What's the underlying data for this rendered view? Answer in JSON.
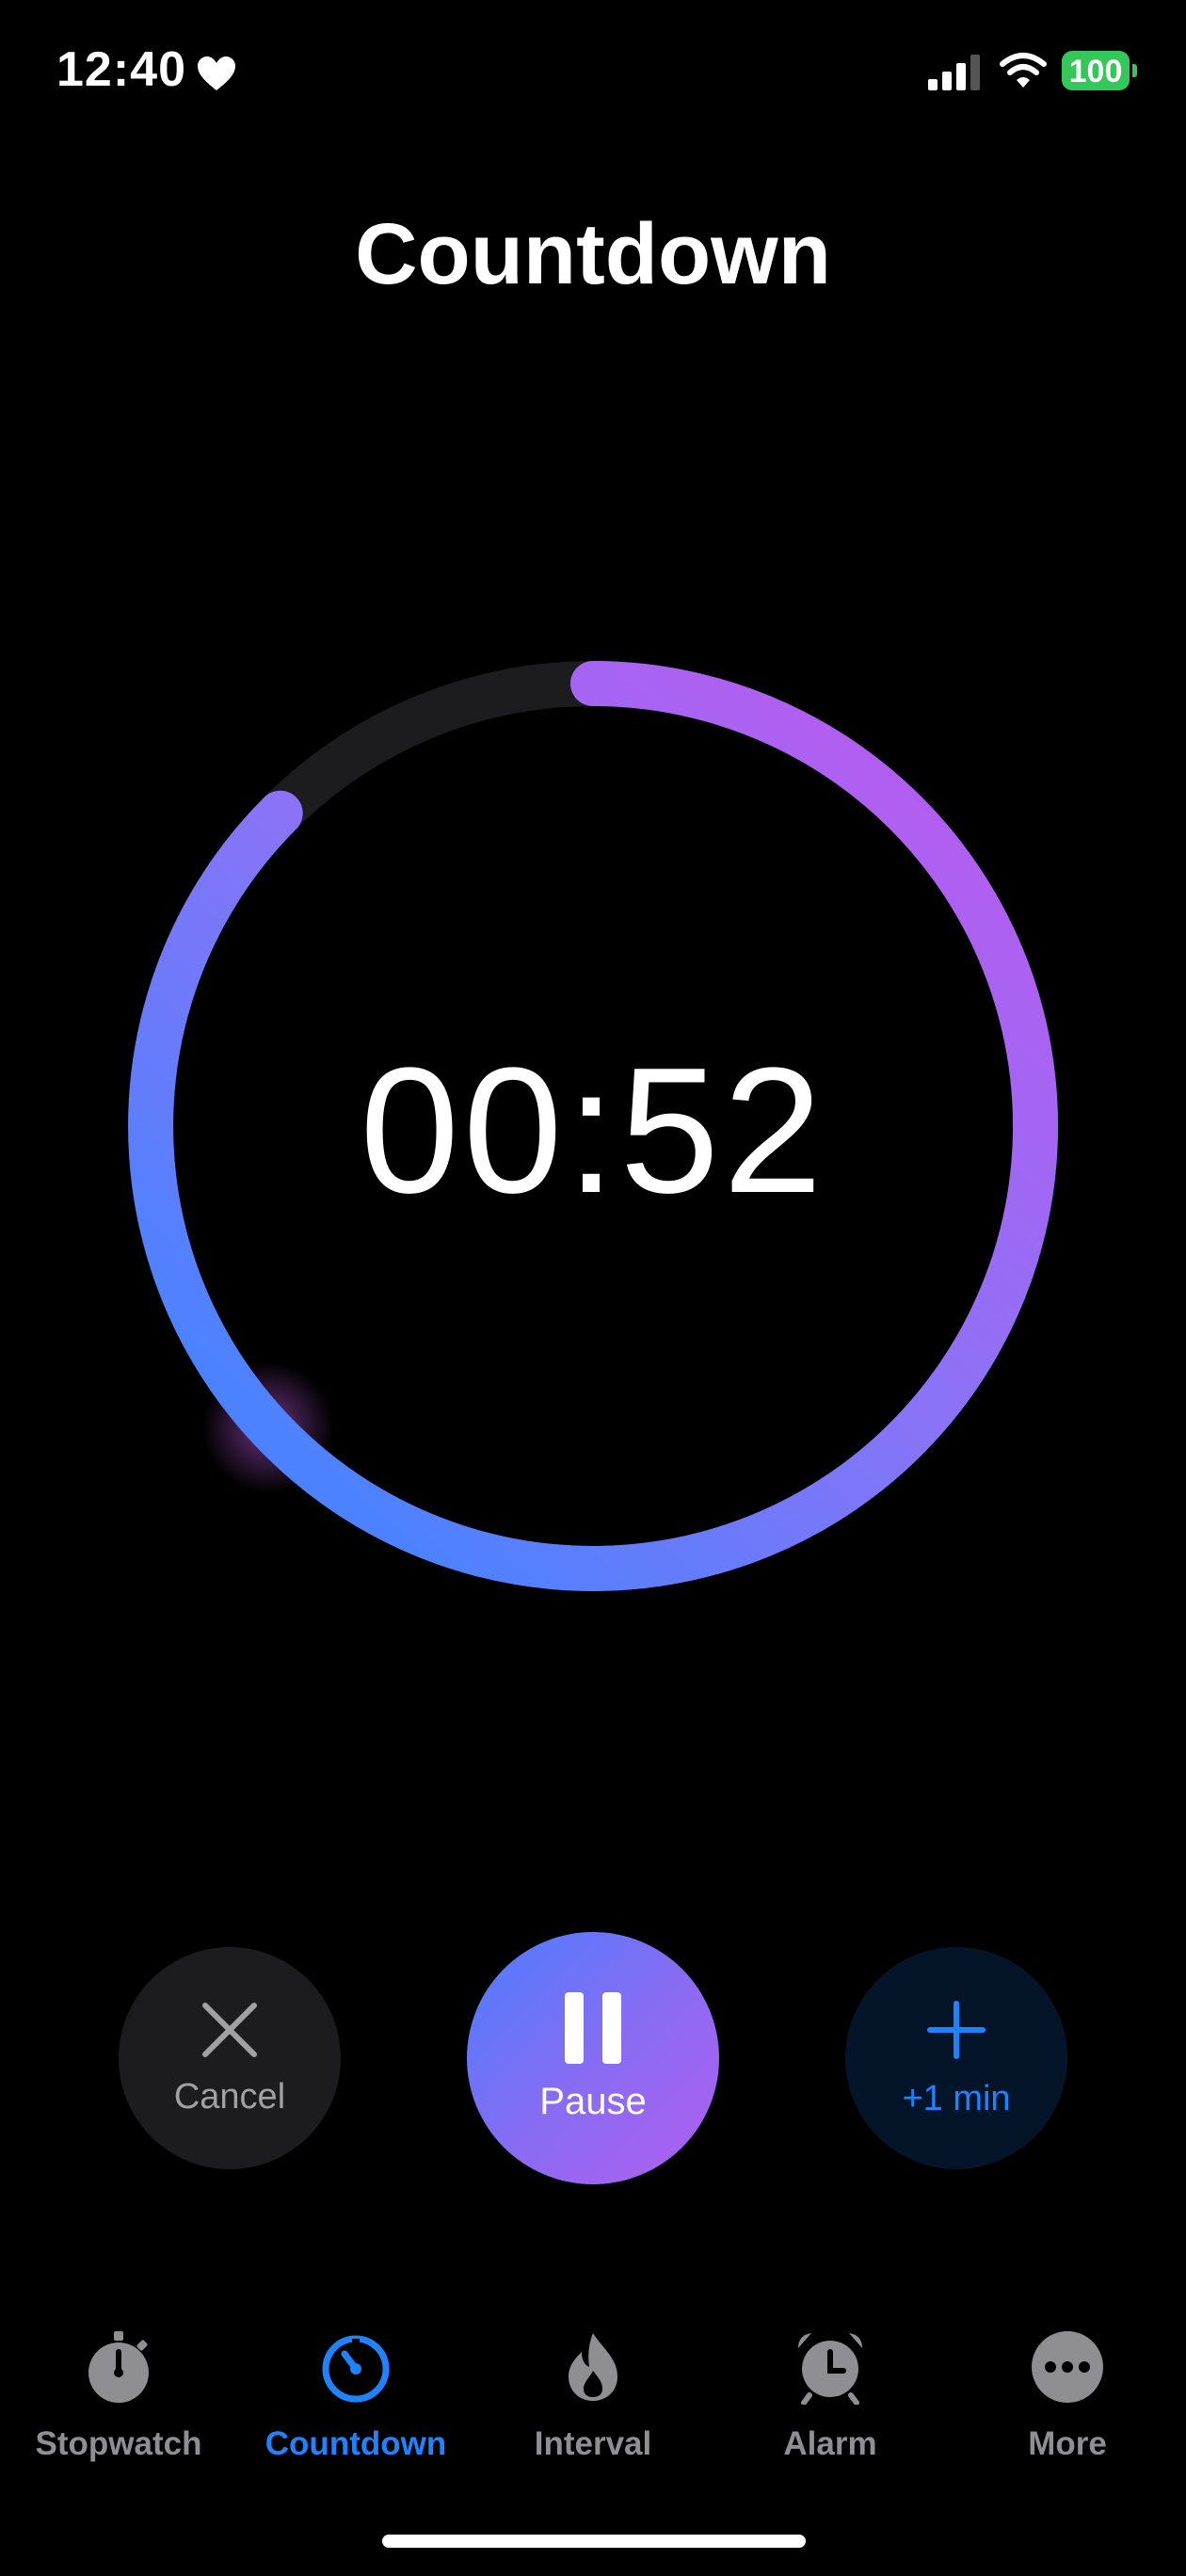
{
  "status": {
    "time": "12:40",
    "battery": "100"
  },
  "page": {
    "title": "Countdown"
  },
  "timer": {
    "display": "00:52",
    "progress_fraction": 0.875
  },
  "controls": {
    "cancel_label": "Cancel",
    "pause_label": "Pause",
    "add_label": "+1 min"
  },
  "tabs": [
    {
      "label": "Stopwatch",
      "icon": "stopwatch-icon",
      "active": false
    },
    {
      "label": "Countdown",
      "icon": "countdown-icon",
      "active": true
    },
    {
      "label": "Interval",
      "icon": "flame-icon",
      "active": false
    },
    {
      "label": "Alarm",
      "icon": "alarm-clock-icon",
      "active": false
    },
    {
      "label": "More",
      "icon": "more-icon",
      "active": false
    }
  ],
  "colors": {
    "accent": "#1f82ff",
    "gradient_start": "#4c7dff",
    "gradient_end": "#b25ef0",
    "battery": "#34c759"
  }
}
